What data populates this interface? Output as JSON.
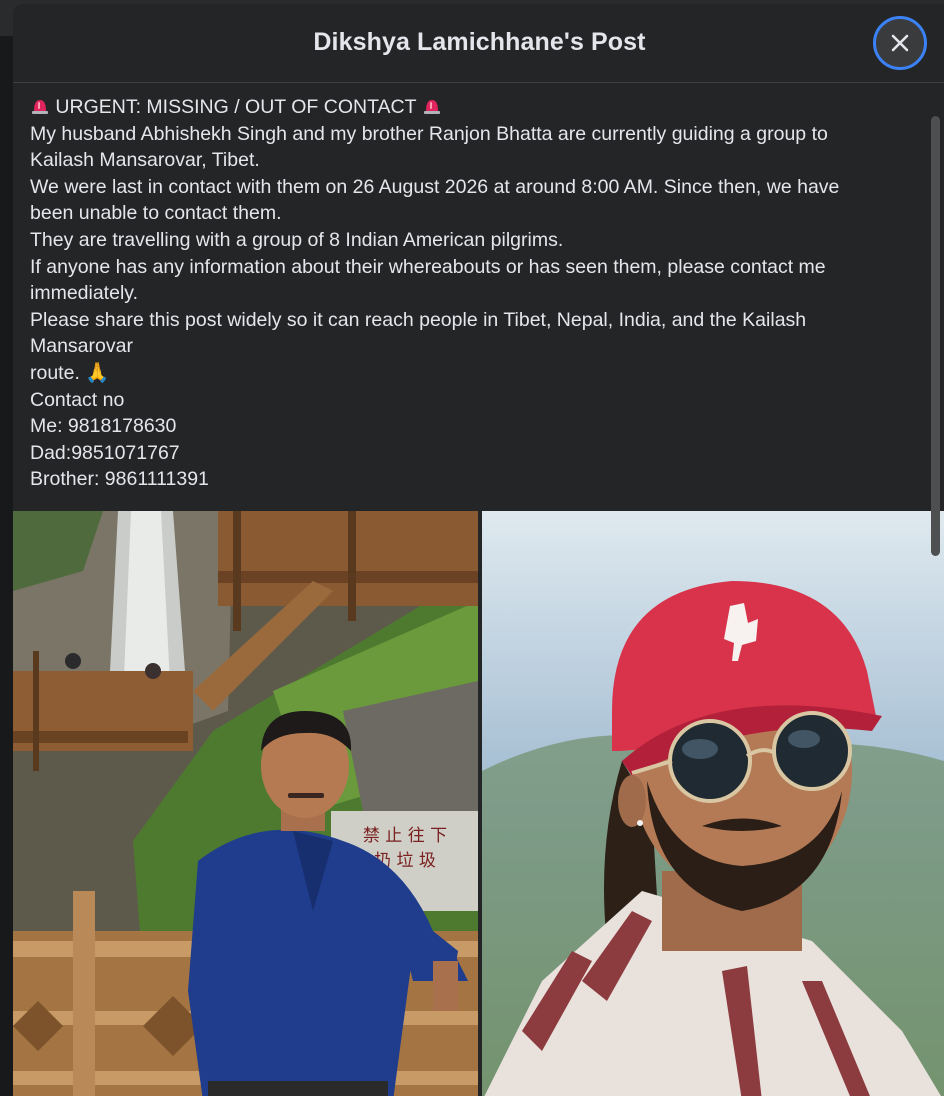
{
  "header": {
    "title": "Dikshya Lamichhane's Post"
  },
  "post": {
    "lines": [
      "URGENT: MISSING / OUT OF CONTACT",
      "My husband Abhishekh Singh and my brother Ranjon Bhatta are currently guiding a group to",
      "Kailash Mansarovar, Tibet.",
      "We were last in contact with them on 26 August 2026 at around 8:00 AM. Since then, we have",
      "been unable to contact them.",
      "They are travelling with a group of 8 Indian American pilgrims.",
      "If anyone has any information about their whereabouts or has seen them, please contact me",
      "immediately.",
      "Please share this post widely so it can reach people in Tibet, Nepal, India, and the Kailash",
      "Mansarovar",
      "route. 🙏",
      "Contact no",
      "Me: 9818178630",
      "Dad:9851071767",
      "Brother: 9861111391"
    ]
  },
  "photos": {
    "left": {
      "sign_line1": "禁 止 往 下",
      "sign_line2": "扔 垃 圾"
    }
  },
  "colors": {
    "background": "#242526",
    "text": "#e4e6eb",
    "close_ring": "#3b82f6"
  },
  "icons": {
    "close": "close-icon",
    "siren": "siren-icon",
    "pray": "folded-hands-emoji"
  }
}
